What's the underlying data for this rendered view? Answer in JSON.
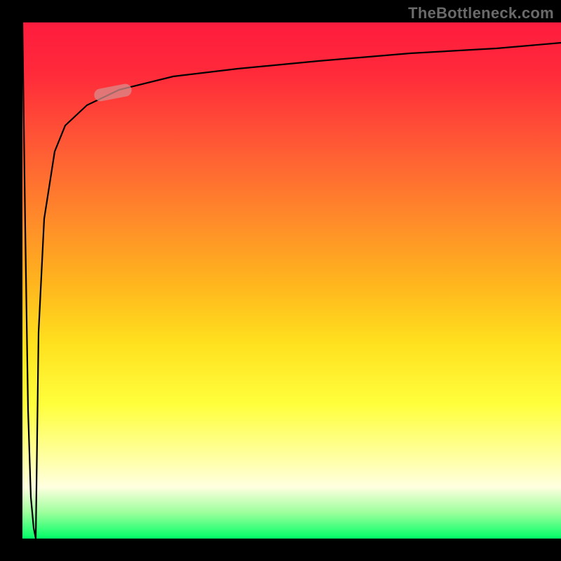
{
  "watermark": "TheBottleneck.com",
  "chart_data": {
    "type": "line",
    "title": "",
    "xlabel": "",
    "ylabel": "",
    "xlim": [
      0,
      100
    ],
    "ylim": [
      0,
      100
    ],
    "gradient_legend": {
      "orientation": "vertical",
      "top_color_meaning": "red (high bottleneck)",
      "bottom_color_meaning": "green (no bottleneck)"
    },
    "series": [
      {
        "name": "bottleneck-curve-down",
        "x": [
          0.0,
          0.5,
          1.0,
          1.5,
          2.0,
          2.5
        ],
        "y": [
          100,
          60,
          25,
          8,
          2,
          0
        ]
      },
      {
        "name": "bottleneck-curve-up",
        "x": [
          2.5,
          3.0,
          4.0,
          6.0,
          8.0,
          12.0,
          18.0,
          28.0,
          40.0,
          55.0,
          72.0,
          88.0,
          100.0
        ],
        "y": [
          0,
          40,
          62,
          75,
          80,
          84,
          87,
          89.5,
          91,
          92.5,
          94,
          95,
          96
        ]
      }
    ],
    "marker": {
      "name": "highlight-segment",
      "x_range": [
        13,
        19
      ],
      "y_range": [
        84,
        87
      ]
    }
  },
  "colors": {
    "curve": "#000000",
    "marker": "#d88c8c",
    "background_black": "#000000"
  }
}
